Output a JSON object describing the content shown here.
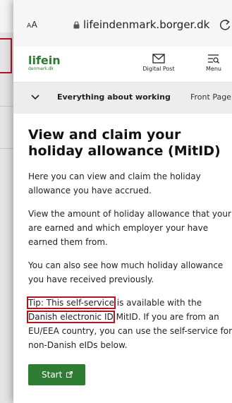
{
  "browser": {
    "text_size_label_small": "A",
    "text_size_label_large": "A",
    "url": "lifeindenmark.borger.dk"
  },
  "site": {
    "logo_main": "lifein",
    "logo_sub": "denmark.dk",
    "digital_post_label": "Digital Post",
    "menu_label": "Menu"
  },
  "breadcrumb": {
    "current": "Everything about working",
    "next": "Front Page"
  },
  "main": {
    "title": "View and claim your holiday allowance (MitID)",
    "p1": "Here you can view and claim the holiday allowance you have accrued.",
    "p2": "View the amount of holiday allowance that your are earned and which employer your have earned them from.",
    "p3": "You can also see how much holiday allowance you have received previously.",
    "tip_highlight": "Tip: This self-service",
    "tip_rest1": " is available with the ",
    "tip_highlight2": "Danish electronic ID",
    "tip_rest2": " MitID. If you are from an EU/EEA country, you can use the self-service for non-Danish eIDs below.",
    "start_label": "Start"
  },
  "colors": {
    "accent_green": "#2e7d32",
    "highlight_red": "#b3141e"
  }
}
